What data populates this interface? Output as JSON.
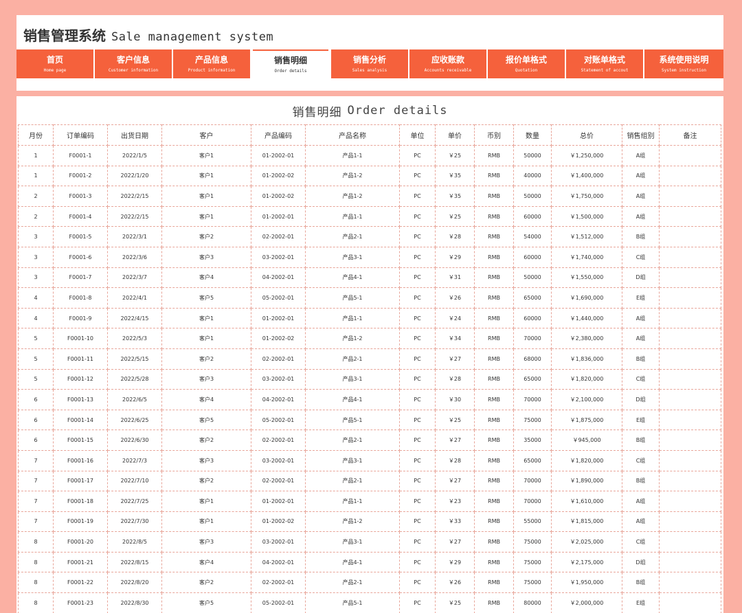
{
  "header": {
    "title_cn": "销售管理系统",
    "title_en": "Sale management system"
  },
  "nav": {
    "tabs": [
      {
        "cn": "首页",
        "en": "Home page",
        "active": false
      },
      {
        "cn": "客户信息",
        "en": "Customer information",
        "active": false
      },
      {
        "cn": "产品信息",
        "en": "Product information",
        "active": false
      },
      {
        "cn": "销售明细",
        "en": "Order details",
        "active": true
      },
      {
        "cn": "销售分析",
        "en": "Sales analysis",
        "active": false
      },
      {
        "cn": "应收账款",
        "en": "Accounts receivable",
        "active": false
      },
      {
        "cn": "报价单格式",
        "en": "Quotation",
        "active": false
      },
      {
        "cn": "对账单格式",
        "en": "Statement of accout",
        "active": false
      },
      {
        "cn": "系统使用说明",
        "en": "System instruction",
        "active": false
      }
    ]
  },
  "sheet": {
    "title_cn": "销售明细",
    "title_en": "Order details"
  },
  "table": {
    "columns": [
      "月份",
      "订单编码",
      "出货日期",
      "客户",
      "产品编码",
      "产品名称",
      "单位",
      "单价",
      "币别",
      "数量",
      "总价",
      "销售组别",
      "备注"
    ],
    "rows": [
      [
        "1",
        "F0001-1",
        "2022/1/5",
        "客户1",
        "01-2002-01",
        "产品1-1",
        "PC",
        "￥25",
        "RMB",
        "50000",
        "￥1,250,000",
        "A组",
        ""
      ],
      [
        "1",
        "F0001-2",
        "2022/1/20",
        "客户1",
        "01-2002-02",
        "产品1-2",
        "PC",
        "￥35",
        "RMB",
        "40000",
        "￥1,400,000",
        "A组",
        ""
      ],
      [
        "2",
        "F0001-3",
        "2022/2/15",
        "客户1",
        "01-2002-02",
        "产品1-2",
        "PC",
        "￥35",
        "RMB",
        "50000",
        "￥1,750,000",
        "A组",
        ""
      ],
      [
        "2",
        "F0001-4",
        "2022/2/15",
        "客户1",
        "01-2002-01",
        "产品1-1",
        "PC",
        "￥25",
        "RMB",
        "60000",
        "￥1,500,000",
        "A组",
        ""
      ],
      [
        "3",
        "F0001-5",
        "2022/3/1",
        "客户2",
        "02-2002-01",
        "产品2-1",
        "PC",
        "￥28",
        "RMB",
        "54000",
        "￥1,512,000",
        "B组",
        ""
      ],
      [
        "3",
        "F0001-6",
        "2022/3/6",
        "客户3",
        "03-2002-01",
        "产品3-1",
        "PC",
        "￥29",
        "RMB",
        "60000",
        "￥1,740,000",
        "C组",
        ""
      ],
      [
        "3",
        "F0001-7",
        "2022/3/7",
        "客户4",
        "04-2002-01",
        "产品4-1",
        "PC",
        "￥31",
        "RMB",
        "50000",
        "￥1,550,000",
        "D组",
        ""
      ],
      [
        "4",
        "F0001-8",
        "2022/4/1",
        "客户5",
        "05-2002-01",
        "产品5-1",
        "PC",
        "￥26",
        "RMB",
        "65000",
        "￥1,690,000",
        "E组",
        ""
      ],
      [
        "4",
        "F0001-9",
        "2022/4/15",
        "客户1",
        "01-2002-01",
        "产品1-1",
        "PC",
        "￥24",
        "RMB",
        "60000",
        "￥1,440,000",
        "A组",
        ""
      ],
      [
        "5",
        "F0001-10",
        "2022/5/3",
        "客户1",
        "01-2002-02",
        "产品1-2",
        "PC",
        "￥34",
        "RMB",
        "70000",
        "￥2,380,000",
        "A组",
        ""
      ],
      [
        "5",
        "F0001-11",
        "2022/5/15",
        "客户2",
        "02-2002-01",
        "产品2-1",
        "PC",
        "￥27",
        "RMB",
        "68000",
        "￥1,836,000",
        "B组",
        ""
      ],
      [
        "5",
        "F0001-12",
        "2022/5/28",
        "客户3",
        "03-2002-01",
        "产品3-1",
        "PC",
        "￥28",
        "RMB",
        "65000",
        "￥1,820,000",
        "C组",
        ""
      ],
      [
        "6",
        "F0001-13",
        "2022/6/5",
        "客户4",
        "04-2002-01",
        "产品4-1",
        "PC",
        "￥30",
        "RMB",
        "70000",
        "￥2,100,000",
        "D组",
        ""
      ],
      [
        "6",
        "F0001-14",
        "2022/6/25",
        "客户5",
        "05-2002-01",
        "产品5-1",
        "PC",
        "￥25",
        "RMB",
        "75000",
        "￥1,875,000",
        "E组",
        ""
      ],
      [
        "6",
        "F0001-15",
        "2022/6/30",
        "客户2",
        "02-2002-01",
        "产品2-1",
        "PC",
        "￥27",
        "RMB",
        "35000",
        "￥945,000",
        "B组",
        ""
      ],
      [
        "7",
        "F0001-16",
        "2022/7/3",
        "客户3",
        "03-2002-01",
        "产品3-1",
        "PC",
        "￥28",
        "RMB",
        "65000",
        "￥1,820,000",
        "C组",
        ""
      ],
      [
        "7",
        "F0001-17",
        "2022/7/10",
        "客户2",
        "02-2002-01",
        "产品2-1",
        "PC",
        "￥27",
        "RMB",
        "70000",
        "￥1,890,000",
        "B组",
        ""
      ],
      [
        "7",
        "F0001-18",
        "2022/7/25",
        "客户1",
        "01-2002-01",
        "产品1-1",
        "PC",
        "￥23",
        "RMB",
        "70000",
        "￥1,610,000",
        "A组",
        ""
      ],
      [
        "7",
        "F0001-19",
        "2022/7/30",
        "客户1",
        "01-2002-02",
        "产品1-2",
        "PC",
        "￥33",
        "RMB",
        "55000",
        "￥1,815,000",
        "A组",
        ""
      ],
      [
        "8",
        "F0001-20",
        "2022/8/5",
        "客户3",
        "03-2002-01",
        "产品3-1",
        "PC",
        "￥27",
        "RMB",
        "75000",
        "￥2,025,000",
        "C组",
        ""
      ],
      [
        "8",
        "F0001-21",
        "2022/8/15",
        "客户4",
        "04-2002-01",
        "产品4-1",
        "PC",
        "￥29",
        "RMB",
        "75000",
        "￥2,175,000",
        "D组",
        ""
      ],
      [
        "8",
        "F0001-22",
        "2022/8/20",
        "客户2",
        "02-2002-01",
        "产品2-1",
        "PC",
        "￥26",
        "RMB",
        "75000",
        "￥1,950,000",
        "B组",
        ""
      ],
      [
        "8",
        "F0001-23",
        "2022/8/30",
        "客户5",
        "05-2002-01",
        "产品5-1",
        "PC",
        "￥25",
        "RMB",
        "80000",
        "￥2,000,000",
        "E组",
        ""
      ]
    ]
  },
  "colors": {
    "accent": "#f5613c",
    "background": "#fbb0a3",
    "grid_border": "#e8a498"
  }
}
